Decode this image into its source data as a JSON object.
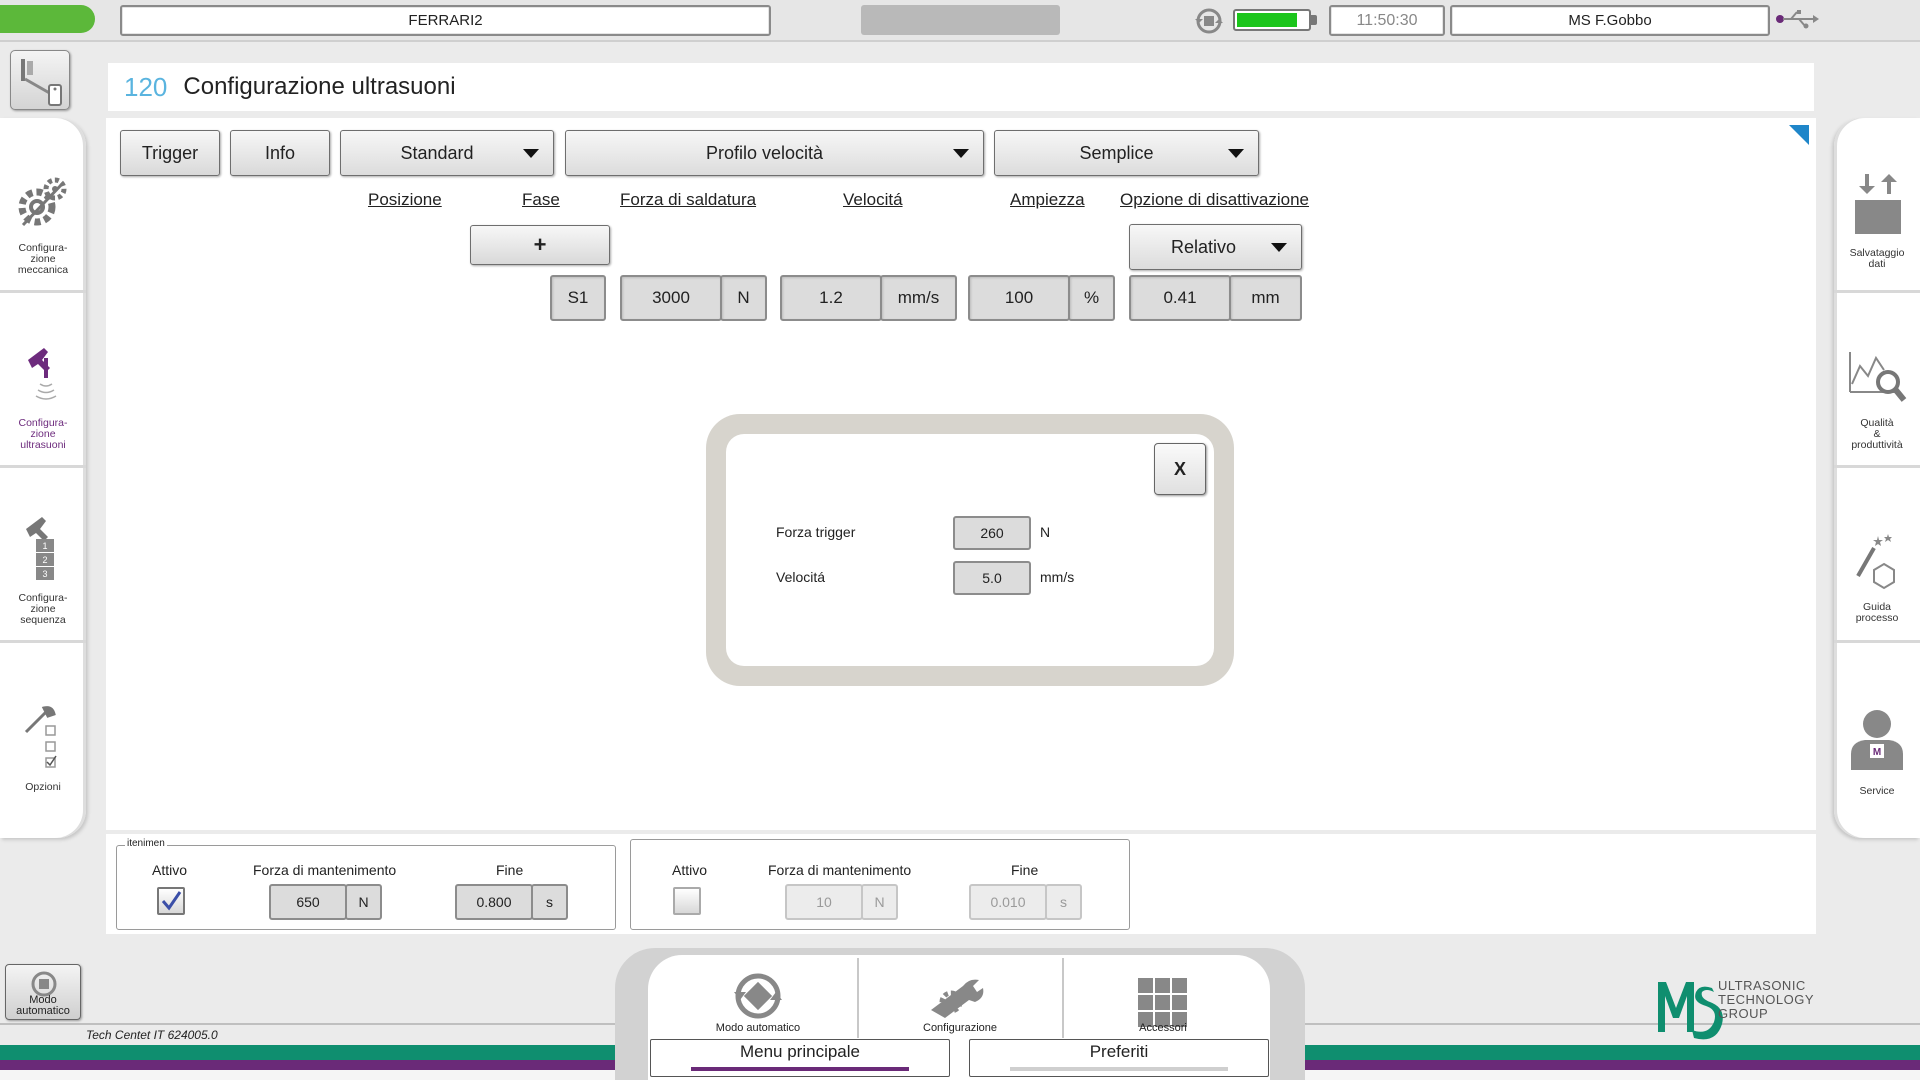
{
  "topbar": {
    "machine_name": "FERRARI2",
    "time": "11:50:30",
    "user": "MS F.Gobbo",
    "battery_level_percent": 85
  },
  "title": {
    "number": "120",
    "text": "Configurazione ultrasuoni"
  },
  "sidebar_left": {
    "items": [
      {
        "label": "Configura-\nzione\nmeccanica",
        "icon": "gears-icon"
      },
      {
        "label": "Configura-\nzione\nultrasuoni",
        "icon": "sonotrode-icon",
        "active": true
      },
      {
        "label": "Configura-\nzione\nsequenza",
        "icon": "sequence-icon"
      },
      {
        "label": "Opzioni",
        "icon": "options-icon"
      }
    ]
  },
  "sidebar_right": {
    "items": [
      {
        "label": "Salvataggio\ndati",
        "icon": "data-save-icon"
      },
      {
        "label": "Qualità\n&\nproduttività",
        "icon": "quality-icon"
      },
      {
        "label": "Guida\nprocesso",
        "icon": "process-guide-icon"
      },
      {
        "label": "Service",
        "icon": "service-icon"
      }
    ]
  },
  "toolbar": {
    "trigger": "Trigger",
    "info": "Info",
    "mode_select": "Standard",
    "profile_select": "Profilo velocità",
    "type_select": "Semplice"
  },
  "table": {
    "headers": {
      "position": "Posizione",
      "phase": "Fase",
      "force": "Forza di saldatura",
      "speed": "Velocitá",
      "amplitude": "Ampiezza",
      "cutoff": "Opzione di disattivazione"
    },
    "add_label": "+",
    "cutoff_select": "Relativo",
    "row": {
      "phase": "S1",
      "force": "3000",
      "force_unit": "N",
      "speed": "1.2",
      "speed_unit": "mm/s",
      "amplitude": "100",
      "amplitude_unit": "%",
      "cutoff": "0.41",
      "cutoff_unit": "mm"
    }
  },
  "popup": {
    "close": "X",
    "trigger_force_label": "Forza trigger",
    "trigger_force_value": "260",
    "trigger_force_unit": "N",
    "speed_label": "Velocitá",
    "speed_value": "5.0",
    "speed_unit": "mm/s"
  },
  "hold": {
    "legend": "itenimen",
    "left": {
      "active_label": "Attivo",
      "active_checked": true,
      "force_label": "Forza di mantenimento",
      "force_value": "650",
      "force_unit": "N",
      "end_label": "Fine",
      "end_value": "0.800",
      "end_unit": "s"
    },
    "right": {
      "active_label": "Attivo",
      "active_checked": false,
      "force_label": "Forza di mantenimento",
      "force_value": "10",
      "force_unit": "N",
      "end_label": "Fine",
      "end_value": "0.010",
      "end_unit": "s"
    }
  },
  "footer": {
    "auto_mode": "Modo automatico",
    "tech_info": "Tech Centet IT 624005.0",
    "nav": {
      "auto": "Modo automatico",
      "config": "Configurazione",
      "accessories": "Accessori"
    },
    "tabs": {
      "main_menu": "Menu principale",
      "favorites": "Preferiti"
    },
    "logo_text": "ULTRASONIC\nTECHNOLOGY\nGROUP"
  },
  "colors": {
    "accent_blue": "#5ab4df",
    "brand_green": "#0f8e6f",
    "brand_purple": "#6a2a78",
    "battery_green": "#1bc51b",
    "status_led": "#5cb83a"
  }
}
